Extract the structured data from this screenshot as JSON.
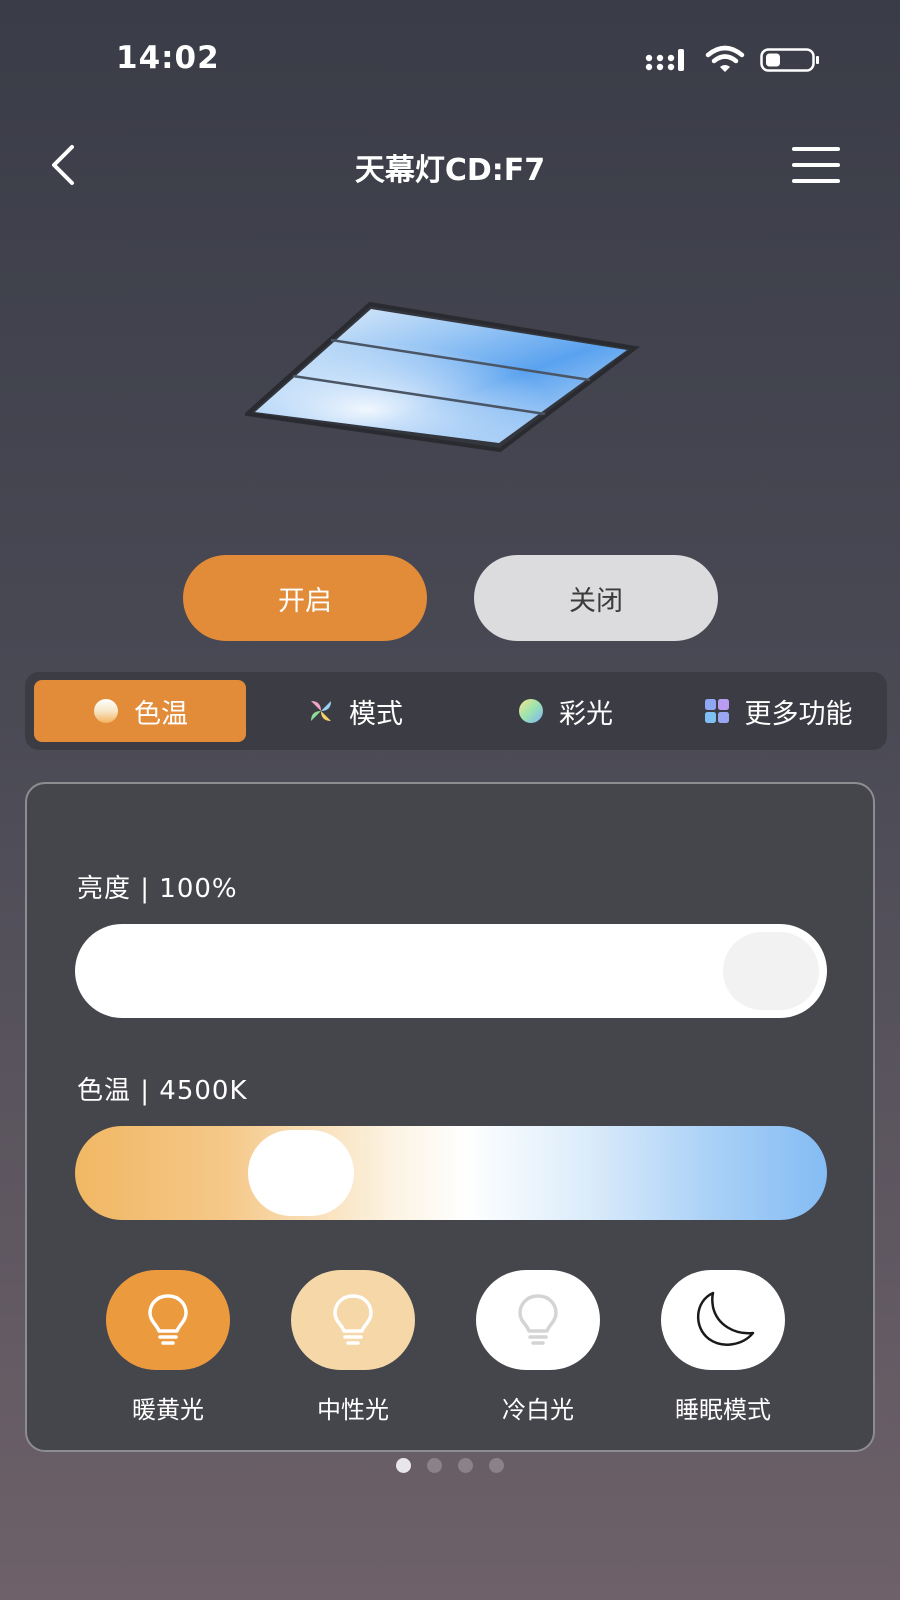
{
  "status_bar": {
    "time": "14:02",
    "signal_icon": "signal-icon",
    "wifi_icon": "wifi-icon",
    "battery_icon": "battery-icon"
  },
  "nav": {
    "back_icon": "chevron-left-icon",
    "title": "天幕灯CD:F7",
    "menu_icon": "hamburger-menu-icon"
  },
  "power": {
    "on_label": "开启",
    "off_label": "关闭",
    "active": "on"
  },
  "tabs": [
    {
      "label": "色温",
      "icon": "color-temperature-icon",
      "active": true
    },
    {
      "label": "模式",
      "icon": "mode-pinwheel-icon",
      "active": false
    },
    {
      "label": "彩光",
      "icon": "color-light-icon",
      "active": false
    },
    {
      "label": "更多功能",
      "icon": "grid-apps-icon",
      "active": false
    }
  ],
  "brightness": {
    "label": "亮度 | 100%",
    "value": 100
  },
  "color_temp": {
    "label": "色温 | 4500K",
    "value_k": 4500,
    "position": 0.23
  },
  "presets": [
    {
      "label": "暖黄光",
      "icon": "lightbulb-icon"
    },
    {
      "label": "中性光",
      "icon": "lightbulb-icon"
    },
    {
      "label": "冷白光",
      "icon": "lightbulb-icon"
    },
    {
      "label": "睡眠模式",
      "icon": "moon-icon"
    }
  ],
  "pager": {
    "count": 4,
    "active_index": 0
  },
  "colors": {
    "accent": "#e28b38",
    "off_button": "#dcdbde",
    "panel": "#45454c",
    "warm": "#f1b763",
    "cool": "#84bcf4"
  }
}
